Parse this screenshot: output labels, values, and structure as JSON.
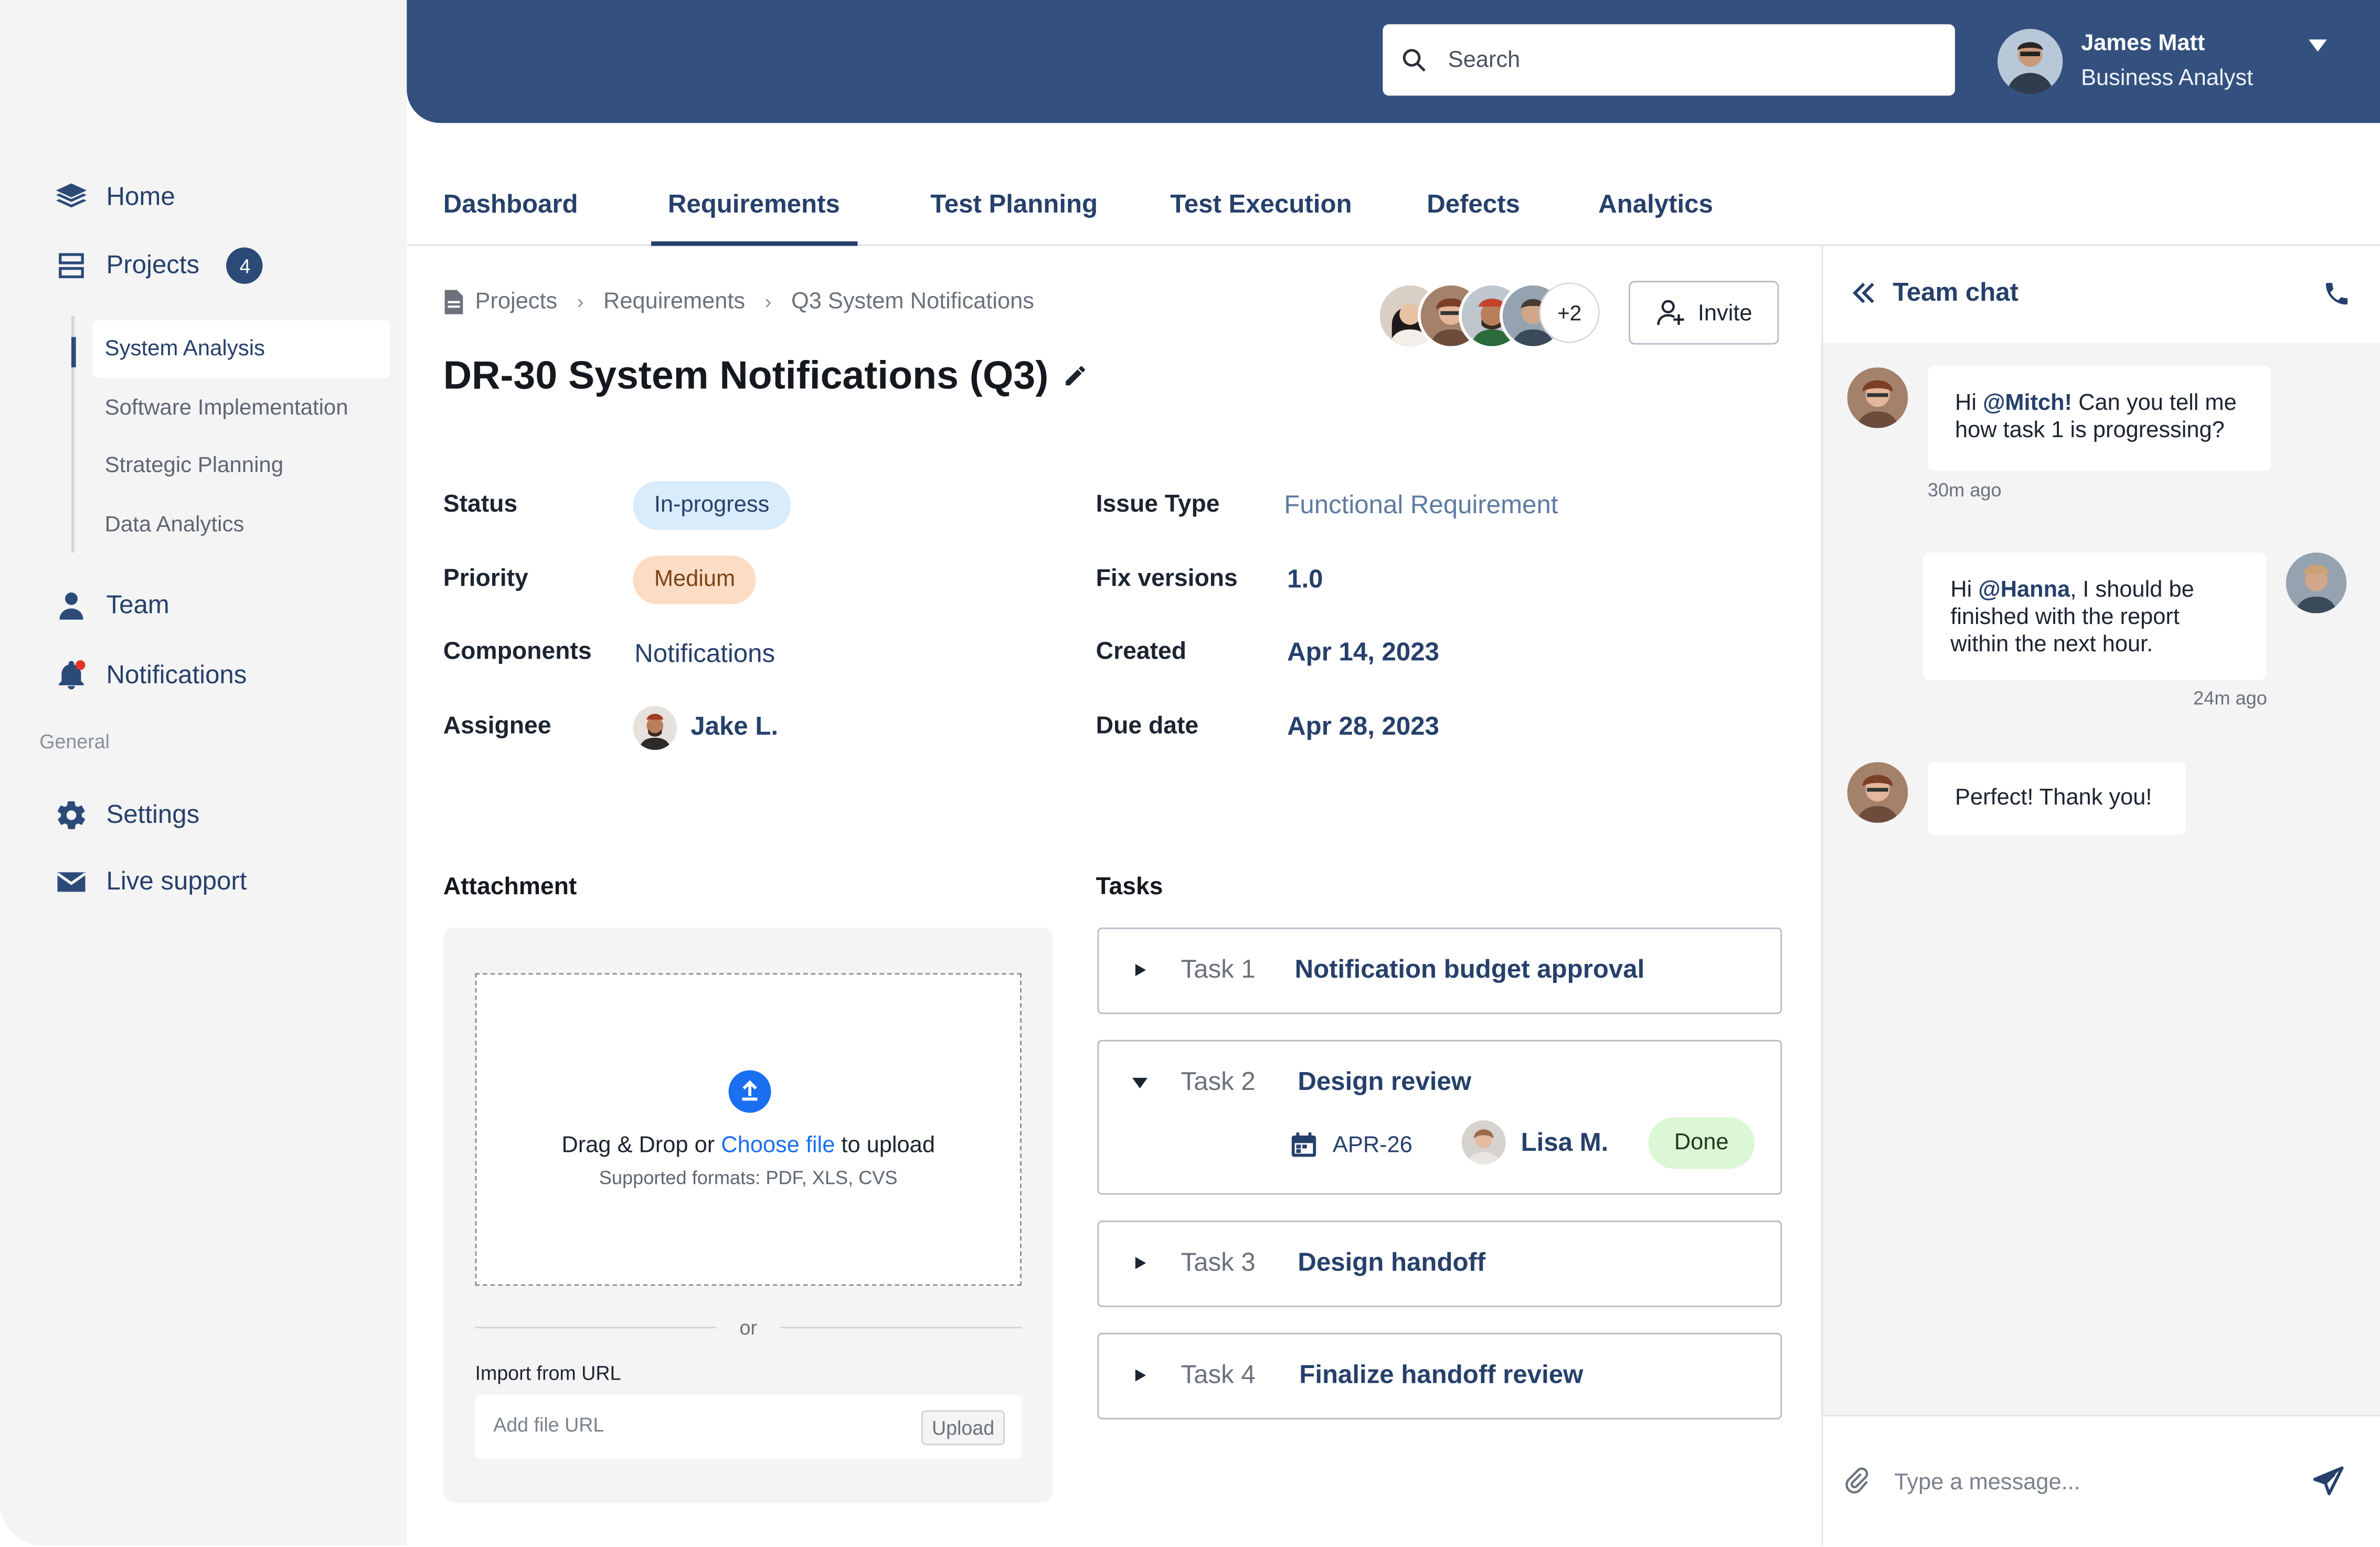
{
  "sidebar": {
    "nav": [
      {
        "label": "Home",
        "icon": "layers-icon"
      },
      {
        "label": "Projects",
        "icon": "projects-icon",
        "badge": "4"
      },
      {
        "label": "Team",
        "icon": "user-icon"
      },
      {
        "label": "Notifications",
        "icon": "bell-icon"
      }
    ],
    "sub_items": [
      "System Analysis",
      "Software Implementation",
      "Strategic Planning",
      "Data Analytics"
    ],
    "section_label": "General",
    "general": [
      {
        "label": "Settings",
        "icon": "gear-icon"
      },
      {
        "label": "Live support",
        "icon": "mail-icon"
      }
    ]
  },
  "header": {
    "search_placeholder": "Search",
    "user_name": "James Matt",
    "user_role": "Business Analyst"
  },
  "tabs": [
    "Dashboard",
    "Requirements",
    "Test Planning",
    "Test Execution",
    "Defects",
    "Analytics"
  ],
  "active_tab": "Requirements",
  "breadcrumb": [
    "Projects",
    "Requirements",
    "Q3 System Notifications"
  ],
  "page_title": "DR-30 System Notifications (Q3)",
  "collaborators_more": "+2",
  "invite_label": "Invite",
  "fields": {
    "status": {
      "label": "Status",
      "value": "In-progress"
    },
    "priority": {
      "label": "Priority",
      "value": "Medium"
    },
    "components": {
      "label": "Components",
      "value": "Notifications"
    },
    "assignee": {
      "label": "Assignee",
      "value": "Jake L."
    },
    "issue_type": {
      "label": "Issue Type",
      "value": "Functional Requirement"
    },
    "fix_versions": {
      "label": "Fix versions",
      "value": "1.0"
    },
    "created": {
      "label": "Created",
      "value": "Apr 14, 2023"
    },
    "due_date": {
      "label": "Due date",
      "value": "Apr 28, 2023"
    }
  },
  "attachment": {
    "title": "Attachment",
    "drop_prefix": "Drag & Drop or ",
    "drop_link": "Choose file",
    "drop_suffix": " to upload",
    "formats": "Supported formats: PDF, XLS, CVS",
    "or": "or",
    "import_label": "Import from URL",
    "url_placeholder": "Add file URL",
    "upload_label": "Upload"
  },
  "tasks": {
    "title": "Tasks",
    "items": [
      {
        "num": "Task 1",
        "name": "Notification budget approval"
      },
      {
        "num": "Task 2",
        "name": "Design review",
        "date": "APR-26",
        "assignee": "Lisa M.",
        "status": "Done"
      },
      {
        "num": "Task 3",
        "name": "Design handoff"
      },
      {
        "num": "Task 4",
        "name": "Finalize handoff review"
      }
    ]
  },
  "chat": {
    "title": "Team chat",
    "messages": [
      {
        "pre": "Hi ",
        "mention": "@Mitch!",
        "post": " Can you tell me how task 1 is progressing?",
        "time": "30m ago"
      },
      {
        "pre": "Hi ",
        "mention": "@Hanna",
        "post": ", I should be finished with the report within the next hour.",
        "time": "24m ago"
      },
      {
        "text": "Perfect! Thank you!"
      }
    ],
    "input_placeholder": "Type a message..."
  },
  "colors": {
    "brand": "#33507e",
    "accent_text": "#26406b",
    "link": "#1a6ff0",
    "status_bg": "#d9ecfb",
    "priority_bg": "#fcdcc4",
    "done_bg": "#dcf7d5"
  }
}
